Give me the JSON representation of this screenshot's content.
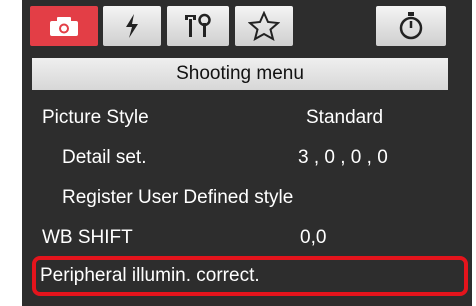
{
  "menu": {
    "title": "Shooting menu",
    "items": [
      {
        "label": "Picture Style",
        "value": "Standard"
      },
      {
        "label": "Detail set.",
        "value": "3 , 0 , 0 , 0"
      },
      {
        "label": "Register User Defined style",
        "value": ""
      },
      {
        "label": "WB SHIFT",
        "value": "0,0"
      },
      {
        "label": "Peripheral illumin. correct.",
        "value": ""
      }
    ]
  },
  "tabs": [
    {
      "icon": "camera-icon",
      "active": true
    },
    {
      "icon": "flash-icon",
      "active": false
    },
    {
      "icon": "tools-icon",
      "active": false
    },
    {
      "icon": "star-icon",
      "active": false
    },
    {
      "icon": "timer-icon",
      "active": false
    }
  ],
  "colors": {
    "active_tab": "#e33e46",
    "panel_background": "#2d2d2d",
    "highlight_border": "#e4141c",
    "menu_text": "#ffffff"
  }
}
